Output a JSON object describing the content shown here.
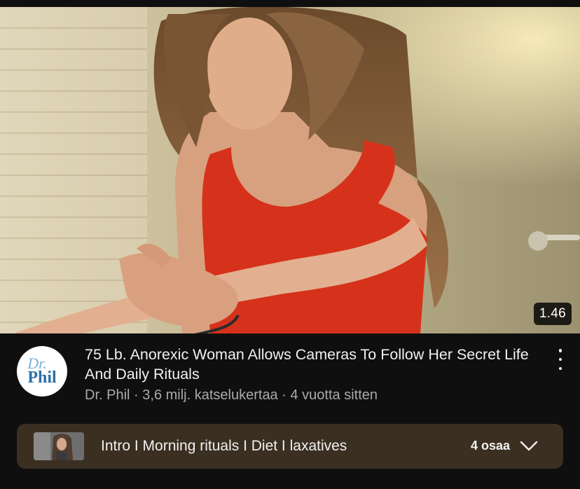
{
  "video": {
    "duration": "1.46",
    "title": "75 Lb. Anorexic Woman Allows Cameras To Follow Her Secret Life And Daily Rituals",
    "channel": "Dr. Phil",
    "views": "3,6 milj. katselukertaa",
    "age": "4 vuotta sitten",
    "separator": "·"
  },
  "channel_avatar": {
    "line1": "Dr.",
    "line2": "Phil"
  },
  "chapters": {
    "title": "Intro I Morning rituals I Diet I laxatives",
    "count": "4 osaa"
  },
  "icons": {
    "menu": "more-vertical-icon",
    "expand": "chevron-down-icon"
  },
  "colors": {
    "background": "#0f0f0f",
    "chapters_bg": "#3b2f22",
    "text_primary": "#f1f1f1",
    "text_secondary": "#aaaaaa"
  }
}
